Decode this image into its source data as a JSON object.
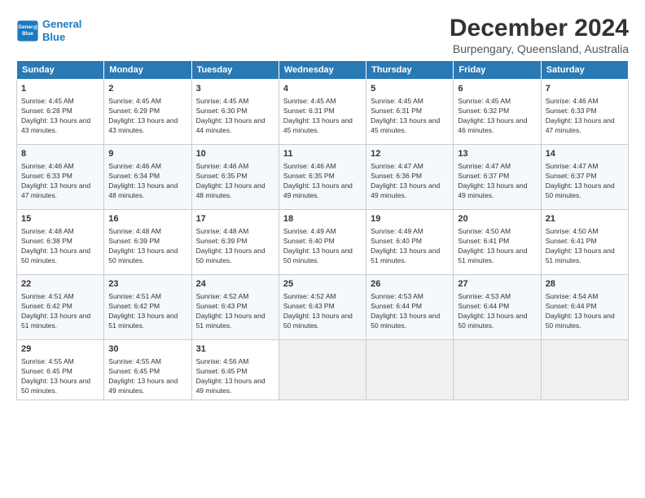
{
  "header": {
    "logo_line1": "General",
    "logo_line2": "Blue",
    "title": "December 2024",
    "subtitle": "Burpengary, Queensland, Australia"
  },
  "days_of_week": [
    "Sunday",
    "Monday",
    "Tuesday",
    "Wednesday",
    "Thursday",
    "Friday",
    "Saturday"
  ],
  "weeks": [
    [
      {
        "day": "1",
        "sunrise": "4:45 AM",
        "sunset": "6:28 PM",
        "daylight": "13 hours and 43 minutes."
      },
      {
        "day": "2",
        "sunrise": "4:45 AM",
        "sunset": "6:29 PM",
        "daylight": "13 hours and 43 minutes."
      },
      {
        "day": "3",
        "sunrise": "4:45 AM",
        "sunset": "6:30 PM",
        "daylight": "13 hours and 44 minutes."
      },
      {
        "day": "4",
        "sunrise": "4:45 AM",
        "sunset": "6:31 PM",
        "daylight": "13 hours and 45 minutes."
      },
      {
        "day": "5",
        "sunrise": "4:45 AM",
        "sunset": "6:31 PM",
        "daylight": "13 hours and 45 minutes."
      },
      {
        "day": "6",
        "sunrise": "4:45 AM",
        "sunset": "6:32 PM",
        "daylight": "13 hours and 46 minutes."
      },
      {
        "day": "7",
        "sunrise": "4:46 AM",
        "sunset": "6:33 PM",
        "daylight": "13 hours and 47 minutes."
      }
    ],
    [
      {
        "day": "8",
        "sunrise": "4:46 AM",
        "sunset": "6:33 PM",
        "daylight": "13 hours and 47 minutes."
      },
      {
        "day": "9",
        "sunrise": "4:46 AM",
        "sunset": "6:34 PM",
        "daylight": "13 hours and 48 minutes."
      },
      {
        "day": "10",
        "sunrise": "4:46 AM",
        "sunset": "6:35 PM",
        "daylight": "13 hours and 48 minutes."
      },
      {
        "day": "11",
        "sunrise": "4:46 AM",
        "sunset": "6:35 PM",
        "daylight": "13 hours and 49 minutes."
      },
      {
        "day": "12",
        "sunrise": "4:47 AM",
        "sunset": "6:36 PM",
        "daylight": "13 hours and 49 minutes."
      },
      {
        "day": "13",
        "sunrise": "4:47 AM",
        "sunset": "6:37 PM",
        "daylight": "13 hours and 49 minutes."
      },
      {
        "day": "14",
        "sunrise": "4:47 AM",
        "sunset": "6:37 PM",
        "daylight": "13 hours and 50 minutes."
      }
    ],
    [
      {
        "day": "15",
        "sunrise": "4:48 AM",
        "sunset": "6:38 PM",
        "daylight": "13 hours and 50 minutes."
      },
      {
        "day": "16",
        "sunrise": "4:48 AM",
        "sunset": "6:39 PM",
        "daylight": "13 hours and 50 minutes."
      },
      {
        "day": "17",
        "sunrise": "4:48 AM",
        "sunset": "6:39 PM",
        "daylight": "13 hours and 50 minutes."
      },
      {
        "day": "18",
        "sunrise": "4:49 AM",
        "sunset": "6:40 PM",
        "daylight": "13 hours and 50 minutes."
      },
      {
        "day": "19",
        "sunrise": "4:49 AM",
        "sunset": "6:40 PM",
        "daylight": "13 hours and 51 minutes."
      },
      {
        "day": "20",
        "sunrise": "4:50 AM",
        "sunset": "6:41 PM",
        "daylight": "13 hours and 51 minutes."
      },
      {
        "day": "21",
        "sunrise": "4:50 AM",
        "sunset": "6:41 PM",
        "daylight": "13 hours and 51 minutes."
      }
    ],
    [
      {
        "day": "22",
        "sunrise": "4:51 AM",
        "sunset": "6:42 PM",
        "daylight": "13 hours and 51 minutes."
      },
      {
        "day": "23",
        "sunrise": "4:51 AM",
        "sunset": "6:42 PM",
        "daylight": "13 hours and 51 minutes."
      },
      {
        "day": "24",
        "sunrise": "4:52 AM",
        "sunset": "6:43 PM",
        "daylight": "13 hours and 51 minutes."
      },
      {
        "day": "25",
        "sunrise": "4:52 AM",
        "sunset": "6:43 PM",
        "daylight": "13 hours and 50 minutes."
      },
      {
        "day": "26",
        "sunrise": "4:53 AM",
        "sunset": "6:44 PM",
        "daylight": "13 hours and 50 minutes."
      },
      {
        "day": "27",
        "sunrise": "4:53 AM",
        "sunset": "6:44 PM",
        "daylight": "13 hours and 50 minutes."
      },
      {
        "day": "28",
        "sunrise": "4:54 AM",
        "sunset": "6:44 PM",
        "daylight": "13 hours and 50 minutes."
      }
    ],
    [
      {
        "day": "29",
        "sunrise": "4:55 AM",
        "sunset": "6:45 PM",
        "daylight": "13 hours and 50 minutes."
      },
      {
        "day": "30",
        "sunrise": "4:55 AM",
        "sunset": "6:45 PM",
        "daylight": "13 hours and 49 minutes."
      },
      {
        "day": "31",
        "sunrise": "4:56 AM",
        "sunset": "6:45 PM",
        "daylight": "13 hours and 49 minutes."
      },
      null,
      null,
      null,
      null
    ]
  ]
}
